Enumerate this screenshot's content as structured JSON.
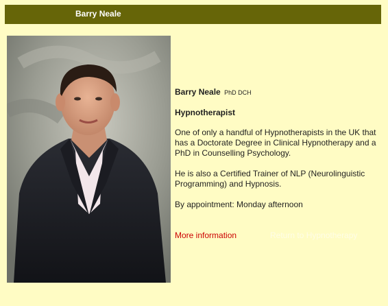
{
  "header": {
    "title": "Barry Neale",
    "bar_color": "#666508"
  },
  "profile": {
    "name": "Barry Neale",
    "credentials": "PhD DCH",
    "role": "Hypnotherapist",
    "paragraphs": [
      "One of only a handful of Hypnotherapists in the UK that has a Doctorate Degree in Clinical Hypnotherapy and a PhD in Counselling Psychology.",
      "He is also a Certified Trainer of NLP (Neurolinguistic Programming) and Hypnosis.",
      "By appointment: Monday afternoon"
    ]
  },
  "links": {
    "more_info": "More information",
    "return": "Return to Hypnotherapy"
  },
  "colors": {
    "background": "#fffcc4",
    "link_red": "#cc0000"
  }
}
